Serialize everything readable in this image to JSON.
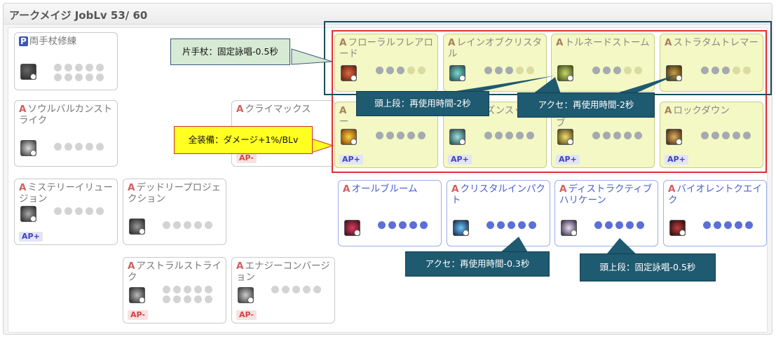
{
  "header": {
    "title": "アークメイジ JobLv 53/ 60"
  },
  "cards": {
    "c1": {
      "type": "P",
      "name": "両手杖修練"
    },
    "c2": {
      "type": "A",
      "name": "ソウルバルカンストライク"
    },
    "c3": {
      "type": "A",
      "name": "クライマックス",
      "badge": "AP-"
    },
    "c4": {
      "type": "A",
      "name": "ミステリーイリュージョン",
      "badge": "AP+"
    },
    "c5": {
      "type": "A",
      "name": "デッドリープロジェクション"
    },
    "c6": {
      "type": "A",
      "name": "アストラルストライク",
      "badge": "AP-"
    },
    "c7": {
      "type": "A",
      "name": "エナジーコンバージョン",
      "badge": "AP-"
    },
    "r1": {
      "type": "A",
      "name": "フローラルフレアロード"
    },
    "r2": {
      "type": "A",
      "name": "レインオブクリスタル"
    },
    "r3": {
      "type": "A",
      "name": "トルネードストーム"
    },
    "r4": {
      "type": "A",
      "name": "ストラタムトレマー"
    },
    "r5": {
      "type": "A",
      "name": "ー",
      "badge": "AP+"
    },
    "r6": {
      "type": "A",
      "name": "ズンスッシュ",
      "badge": "AP+"
    },
    "r7": {
      "type": "A",
      "name": "ブ",
      "badge": "AP+"
    },
    "r8": {
      "type": "A",
      "name": "ロックダウン",
      "badge": "AP+"
    },
    "b1": {
      "type": "A",
      "name": "オールブルーム"
    },
    "b2": {
      "type": "A",
      "name": "クリスタルインパクト"
    },
    "b3": {
      "type": "A",
      "name": "ディストラクティブハリケーン"
    },
    "b4": {
      "type": "A",
      "name": "バイオレントクエイク"
    }
  },
  "callouts": {
    "onehand": "片手杖：固定詠唱-0.5秒",
    "allgear": "全装備：ダメージ+1%/BLv",
    "head_top_1": "頭上段：再使用時間-2秒",
    "accessory_1": "アクセ：再使用時間-2秒",
    "accessory_2": "アクセ：再使用時間-0.3秒",
    "head_top_2": "頭上段：固定詠唱-0.5秒"
  },
  "colors": {
    "highlight_fill": "#f4f8c4",
    "red_frame": "#e03030",
    "teal_frame": "#1b4b5c",
    "callout_teal": "#1e5a70",
    "callout_yellow": "#ffff22",
    "callout_green": "#d6ead4",
    "skill_blue": "#4a5fd0",
    "ap_minus": "#d84040",
    "ap_plus": "#3c44b8"
  }
}
